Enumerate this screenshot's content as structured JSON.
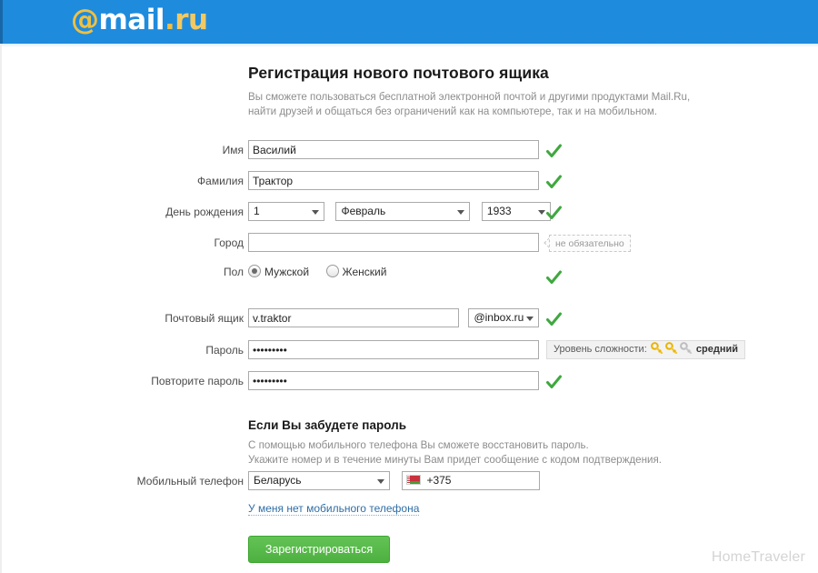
{
  "header": {
    "logo_at": "@",
    "logo_mail": "mail",
    "logo_dot": ".",
    "logo_ru": "ru",
    "bg_color": "#1f8bdd"
  },
  "page": {
    "title": "Регистрация нового почтового ящика",
    "subtitle_line1": "Вы сможете пользоваться бесплатной электронной почтой и другими продуктами Mail.Ru,",
    "subtitle_line2": "найти друзей и общаться без ограничений как на компьютере, так и на мобильном."
  },
  "form": {
    "first_name": {
      "label": "Имя",
      "value": "Василий",
      "placeholder": "",
      "valid": true
    },
    "last_name": {
      "label": "Фамилия",
      "value": "Трактор",
      "placeholder": "",
      "valid": true
    },
    "birthday": {
      "label": "День рождения",
      "day": "1",
      "month": "Февраль",
      "year": "1933",
      "valid": true
    },
    "city": {
      "label": "Город",
      "value": "",
      "placeholder": "",
      "hint": "не обязательно"
    },
    "gender": {
      "label": "Пол",
      "male_label": "Мужской",
      "female_label": "Женский",
      "selected": "male",
      "valid": true
    },
    "mailbox": {
      "label": "Почтовый ящик",
      "value": "v.traktor",
      "domain": "@inbox.ru",
      "valid": true
    },
    "password": {
      "label": "Пароль",
      "value": "•••••••••",
      "strength_label": "Уровень сложности:",
      "strength_value": "средний",
      "keys_filled": 2,
      "keys_total": 3
    },
    "password_repeat": {
      "label": "Повторите пароль",
      "value": "•••••••••",
      "valid": true
    }
  },
  "recovery": {
    "title": "Если Вы забудете пароль",
    "line1": "С помощью мобильного телефона Вы сможете восстановить пароль.",
    "line2": "Укажите номер и в течение минуты Вам придет сообщение с кодом подтверждения.",
    "phone_label": "Мобильный телефон",
    "country": "Беларусь",
    "dial_code": "+375",
    "phone_value": "",
    "no_phone_link": "У меня нет мобильного телефона"
  },
  "actions": {
    "submit_label": "Зарегистрироваться"
  },
  "watermark": "HomeTraveler",
  "colors": {
    "header_blue": "#1f8bdd",
    "submit_green": "#4db03f",
    "check_green": "#3fa83f",
    "link_blue": "#2f6ea5",
    "key_gold": "#f2c430"
  }
}
